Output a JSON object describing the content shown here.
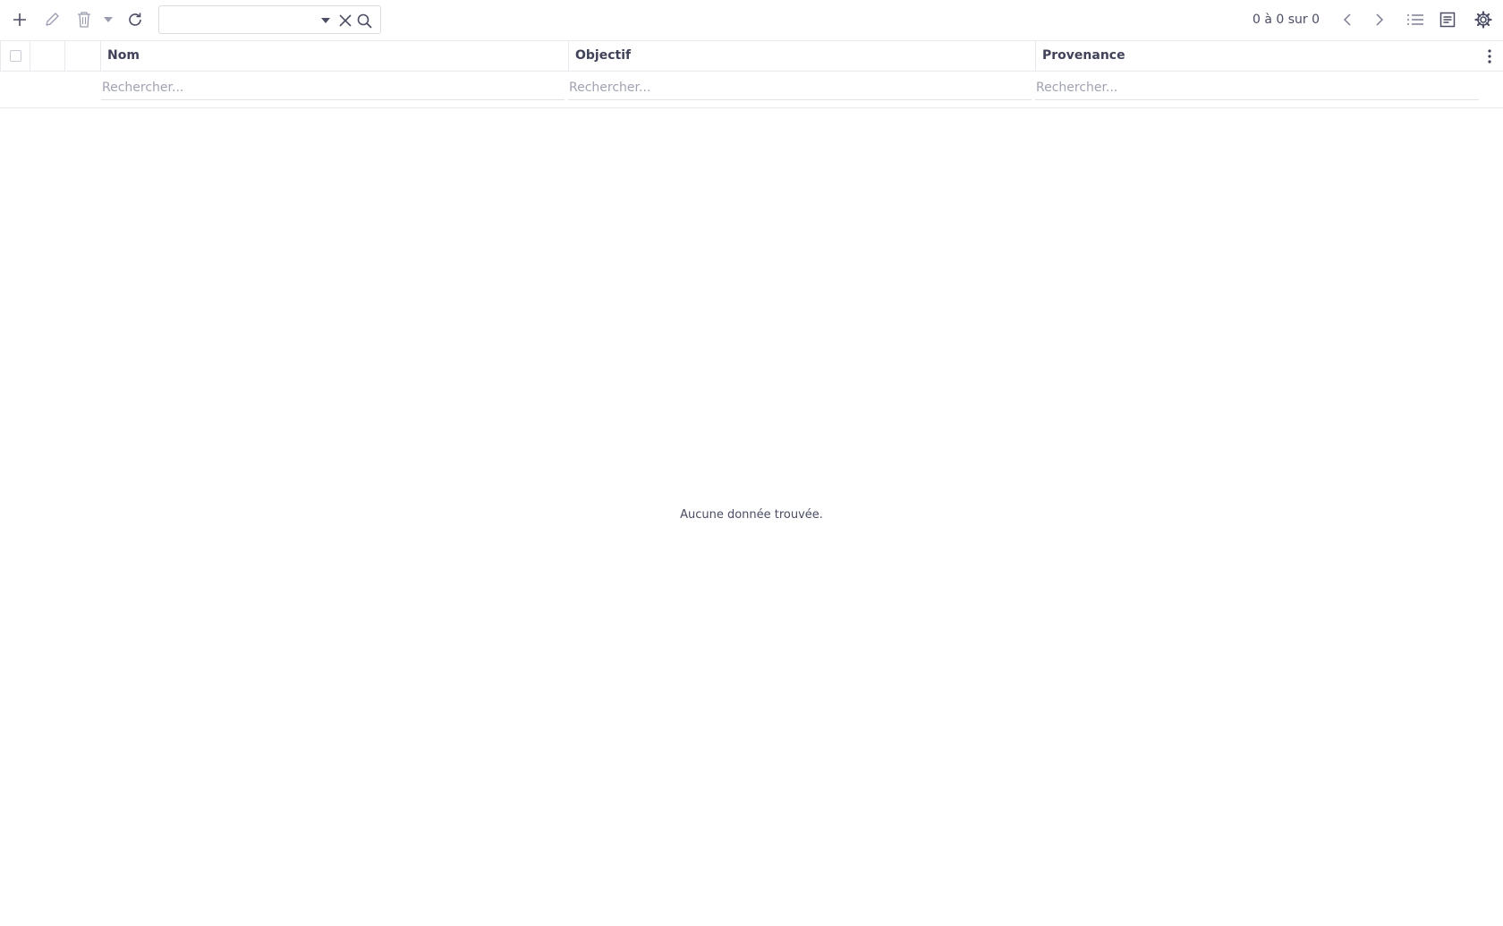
{
  "toolbar": {
    "buttons": [
      "add-icon",
      "edit-icon",
      "delete-icon",
      "caret-down-icon",
      "refresh-icon"
    ],
    "search": {
      "value": "",
      "placeholder": ""
    },
    "pager": {
      "text": "0 à 0 sur 0"
    },
    "right_icons": [
      "chevron-left-icon",
      "chevron-right-icon",
      "list-view-icon",
      "form-view-icon",
      "settings-gear-icon"
    ]
  },
  "grid": {
    "columns": [
      {
        "label": "Nom",
        "filter_placeholder": "Rechercher..."
      },
      {
        "label": "Objectif",
        "filter_placeholder": "Rechercher..."
      },
      {
        "label": "Provenance",
        "filter_placeholder": "Rechercher..."
      }
    ],
    "empty_message": "Aucune donnée trouvée."
  },
  "colors": {
    "icon": "#4a4d63",
    "border": "#e8e9ee",
    "placeholder": "#a0a3b1"
  }
}
